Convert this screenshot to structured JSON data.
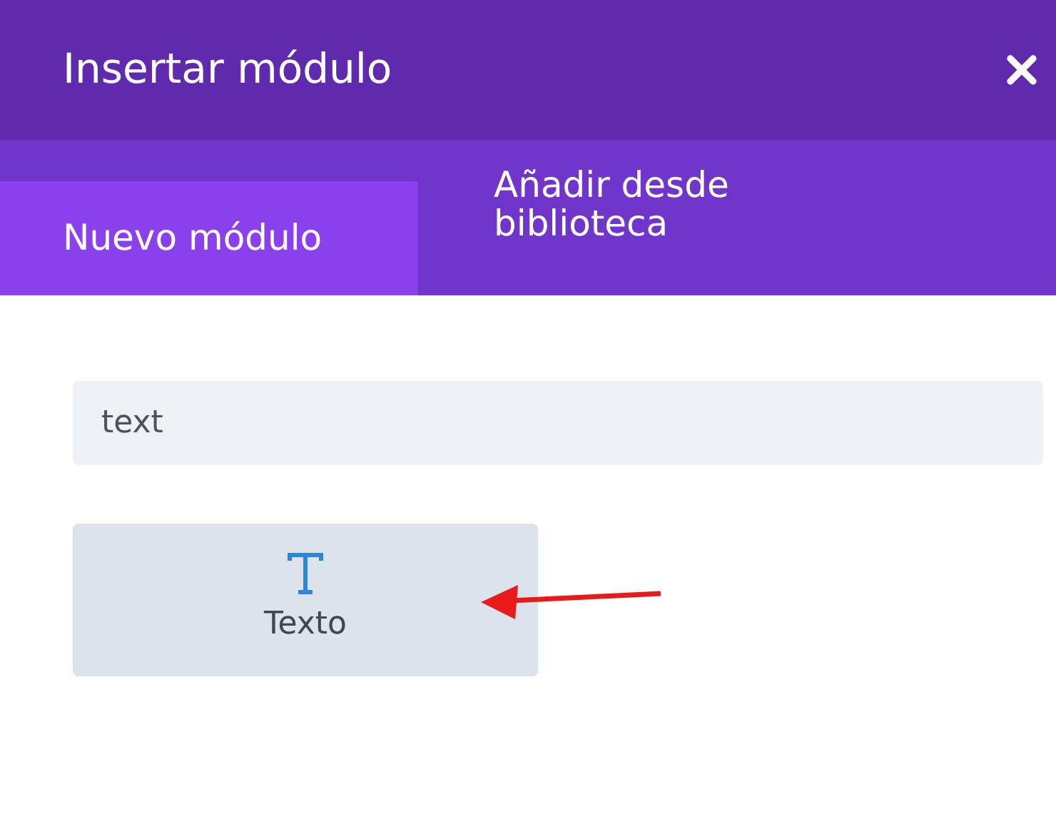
{
  "window": {
    "title": "Insertar módulo"
  },
  "tabs": [
    {
      "label": "Nuevo módulo",
      "selected": true
    },
    {
      "label": "Añadir desde biblioteca",
      "selected": false
    }
  ],
  "search": {
    "value": "text"
  },
  "modules": [
    {
      "label": "Texto",
      "highlighted": true
    }
  ]
}
